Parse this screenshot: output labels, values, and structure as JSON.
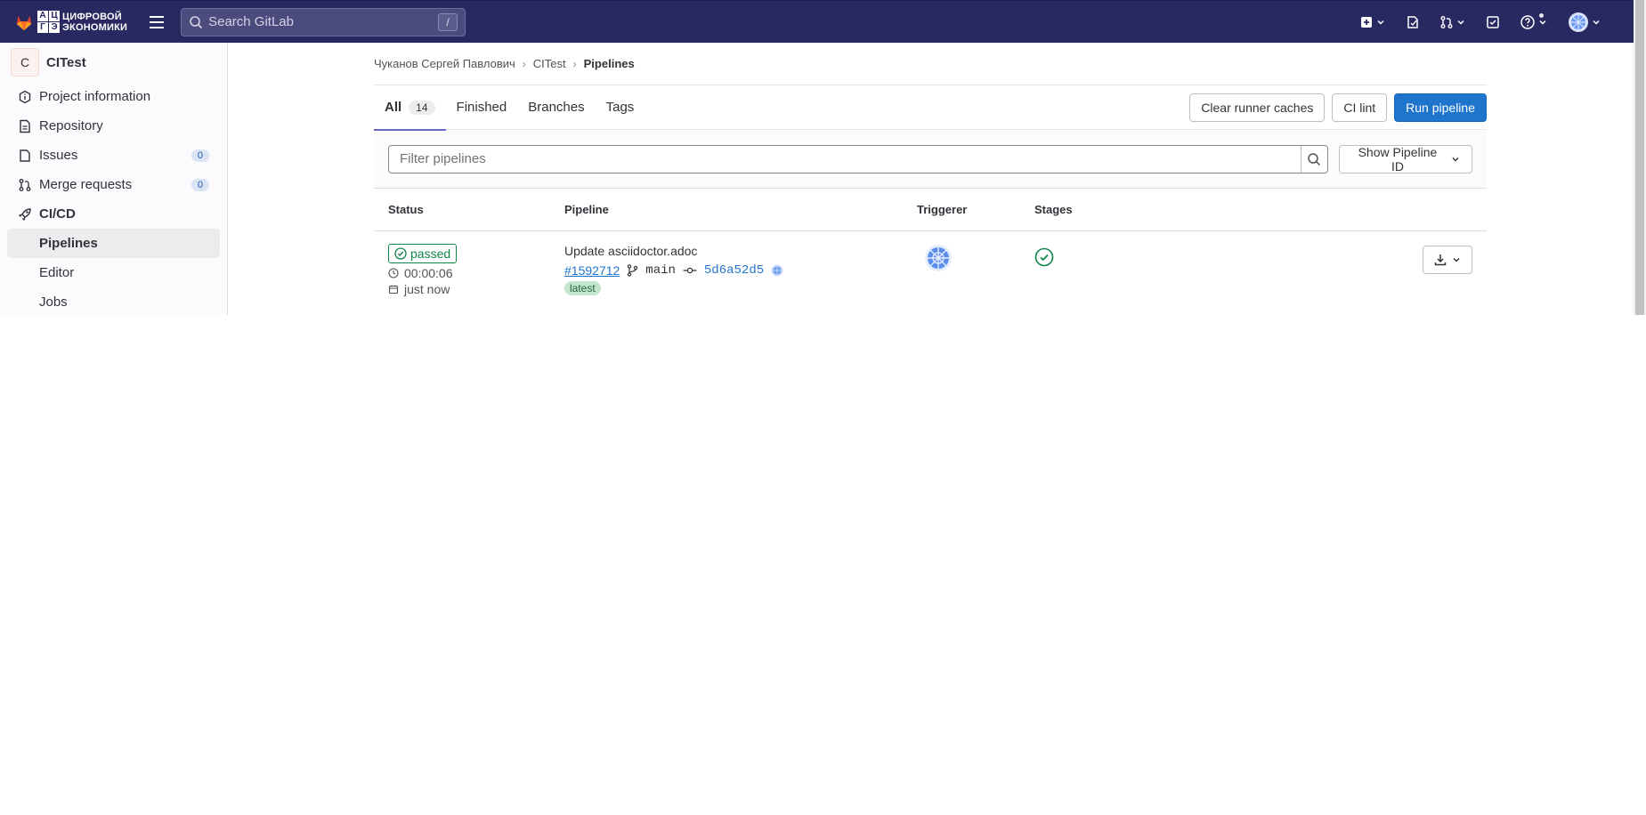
{
  "brand": {
    "logo_letters": [
      "А",
      "Ц",
      "Г",
      "Э"
    ],
    "line1": "ЦИФРОВОЙ",
    "line2": "ЭКОНОМИКИ"
  },
  "search": {
    "placeholder": "Search GitLab",
    "shortcut": "/"
  },
  "colors": {
    "topbar": "#292961",
    "primary": "#1f75cb",
    "success": "#108548",
    "active_tab": "#6666c4"
  },
  "sidebar": {
    "project_initial": "C",
    "project_name": "CITest",
    "items": [
      {
        "label": "Project information",
        "icon": "info-icon"
      },
      {
        "label": "Repository",
        "icon": "document-icon"
      },
      {
        "label": "Issues",
        "icon": "issues-icon",
        "count": "0"
      },
      {
        "label": "Merge requests",
        "icon": "merge-request-icon",
        "count": "0"
      },
      {
        "label": "CI/CD",
        "icon": "rocket-icon"
      }
    ],
    "sub_items": [
      "Pipelines",
      "Editor",
      "Jobs"
    ]
  },
  "breadcrumb": [
    "Чуканов Сергей Павлович",
    "CITest",
    "Pipelines"
  ],
  "tabs": [
    {
      "label": "All",
      "count": "14"
    },
    {
      "label": "Finished"
    },
    {
      "label": "Branches"
    },
    {
      "label": "Tags"
    }
  ],
  "actions": {
    "clear_caches": "Clear runner caches",
    "ci_lint": "CI lint",
    "run_pipeline": "Run pipeline"
  },
  "filter": {
    "placeholder": "Filter pipelines",
    "show_id": "Show Pipeline ID"
  },
  "table": {
    "headers": [
      "Status",
      "Pipeline",
      "Triggerer",
      "Stages"
    ],
    "rows": [
      {
        "status": "passed",
        "duration": "00:00:06",
        "finished": "just now",
        "commit_title": "Update asciidoctor.adoc",
        "pipeline_id": "#1592712",
        "branch": "main",
        "sha": "5d6a52d5",
        "tag": "latest"
      }
    ]
  }
}
